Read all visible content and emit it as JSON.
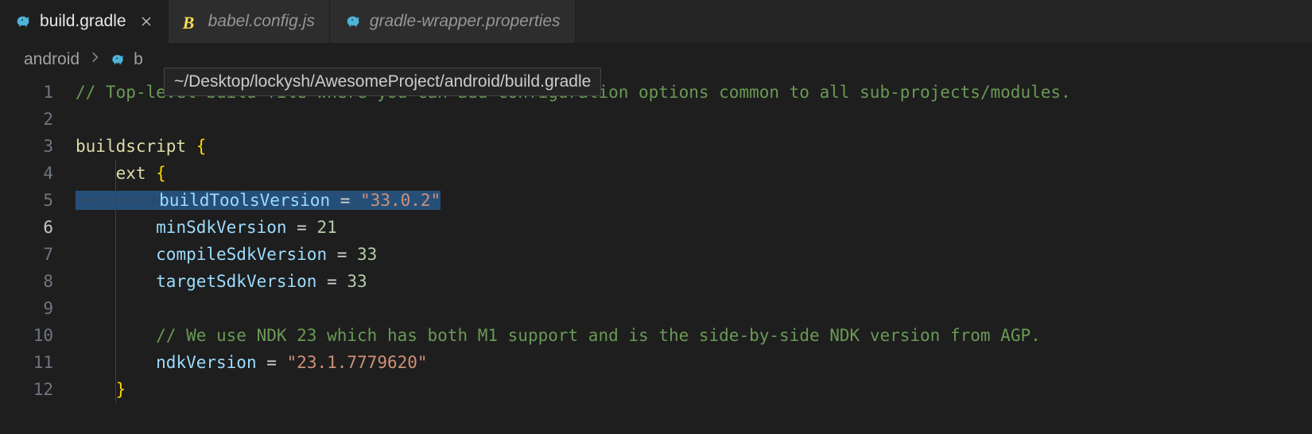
{
  "tabs": [
    {
      "label": "build.gradle",
      "active": true,
      "icon": "elephant",
      "icon_color": "#4fb3d9"
    },
    {
      "label": "babel.config.js",
      "active": false,
      "icon": "babel",
      "icon_color": "#f5da55"
    },
    {
      "label": "gradle-wrapper.properties",
      "active": false,
      "icon": "elephant",
      "icon_color": "#4fb3d9"
    }
  ],
  "breadcrumb": {
    "parts": [
      "android",
      "b"
    ]
  },
  "tooltip": "~/Desktop/lockysh/AwesomeProject/android/build.gradle",
  "lines": [
    {
      "n": 1,
      "content": [
        {
          "t": "// Top-level build file where you can add configuration options common to all sub-projects/modules.",
          "c": "tk-comment"
        }
      ]
    },
    {
      "n": 2,
      "content": []
    },
    {
      "n": 3,
      "content": [
        {
          "t": "buildscript ",
          "c": "tk-keyword"
        },
        {
          "t": "{",
          "c": "tk-punct"
        }
      ]
    },
    {
      "n": 4,
      "content": [
        {
          "t": "    ",
          "c": ""
        },
        {
          "t": "ext ",
          "c": "tk-keyword"
        },
        {
          "t": "{",
          "c": "tk-punct"
        }
      ]
    },
    {
      "n": 5,
      "highlight": true,
      "content": [
        {
          "t": "········",
          "c": "tk-ws-dot"
        },
        {
          "t": "buildToolsVersion",
          "c": "tk-prop"
        },
        {
          "t": " = ",
          "c": "tk-op"
        },
        {
          "t": "\"33.0.2\"",
          "c": "tk-string"
        }
      ]
    },
    {
      "n": 6,
      "current": true,
      "content": [
        {
          "t": "        ",
          "c": ""
        },
        {
          "t": "minSdkVersion",
          "c": "tk-prop"
        },
        {
          "t": " = ",
          "c": "tk-op"
        },
        {
          "t": "21",
          "c": "tk-num"
        }
      ]
    },
    {
      "n": 7,
      "content": [
        {
          "t": "        ",
          "c": ""
        },
        {
          "t": "compileSdkVersion",
          "c": "tk-prop"
        },
        {
          "t": " = ",
          "c": "tk-op"
        },
        {
          "t": "33",
          "c": "tk-num"
        }
      ]
    },
    {
      "n": 8,
      "content": [
        {
          "t": "        ",
          "c": ""
        },
        {
          "t": "targetSdkVersion",
          "c": "tk-prop"
        },
        {
          "t": " = ",
          "c": "tk-op"
        },
        {
          "t": "33",
          "c": "tk-num"
        }
      ]
    },
    {
      "n": 9,
      "content": []
    },
    {
      "n": 10,
      "content": [
        {
          "t": "        ",
          "c": ""
        },
        {
          "t": "// We use NDK 23 which has both M1 support and is the side-by-side NDK version from AGP.",
          "c": "tk-comment"
        }
      ]
    },
    {
      "n": 11,
      "content": [
        {
          "t": "        ",
          "c": ""
        },
        {
          "t": "ndkVersion",
          "c": "tk-prop"
        },
        {
          "t": " = ",
          "c": "tk-op"
        },
        {
          "t": "\"23.1.7779620\"",
          "c": "tk-string"
        }
      ]
    },
    {
      "n": 12,
      "content": [
        {
          "t": "    ",
          "c": ""
        },
        {
          "t": "}",
          "c": "tk-punct"
        }
      ]
    }
  ]
}
